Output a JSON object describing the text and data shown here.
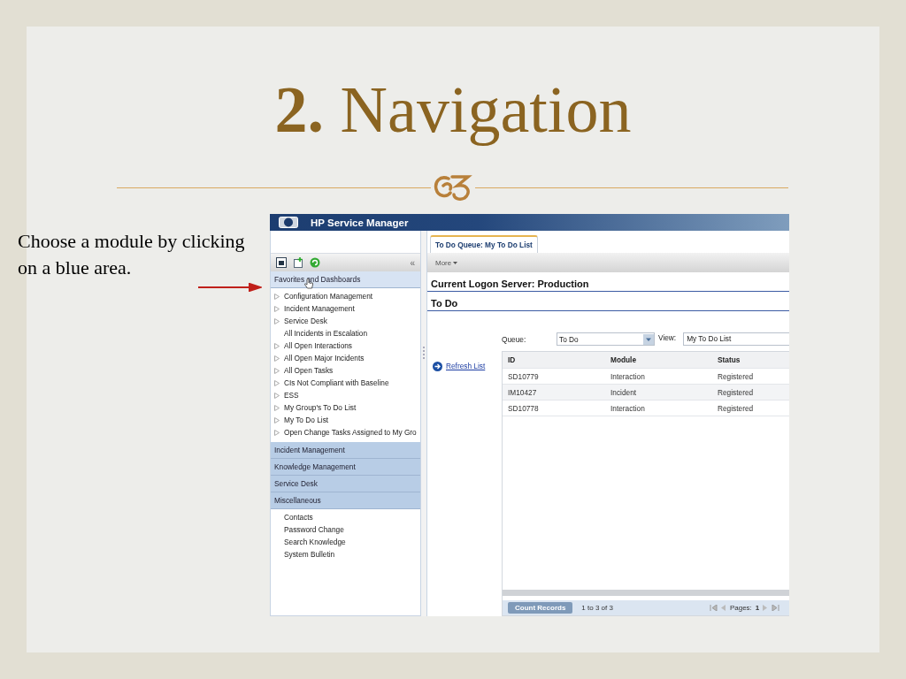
{
  "slide": {
    "title": "**2.** Navigation",
    "caption": "Choose a module by clicking on a blue area."
  },
  "app": {
    "title": "HP Service Manager",
    "sidebar": {
      "collapse": "«",
      "sections": [
        {
          "label": "Favorites and Dashboards",
          "selected": true,
          "items": [
            {
              "label": "Configuration Management",
              "expandable": true
            },
            {
              "label": "Incident Management",
              "expandable": true
            },
            {
              "label": "Service Desk",
              "expandable": true
            },
            {
              "label": "All Incidents in Escalation",
              "expandable": false
            },
            {
              "label": "All Open Interactions",
              "expandable": true
            },
            {
              "label": "All Open Major Incidents",
              "expandable": true
            },
            {
              "label": "All Open Tasks",
              "expandable": true
            },
            {
              "label": "CIs Not Compliant with Baseline",
              "expandable": true
            },
            {
              "label": "ESS",
              "expandable": true
            },
            {
              "label": "My Group's To Do List",
              "expandable": true
            },
            {
              "label": "My To Do List",
              "expandable": true
            },
            {
              "label": "Open Change Tasks Assigned to My Gro",
              "expandable": true
            }
          ]
        },
        {
          "label": "Incident Management",
          "selected": false
        },
        {
          "label": "Knowledge Management",
          "selected": false
        },
        {
          "label": "Service Desk",
          "selected": false
        },
        {
          "label": "Miscellaneous",
          "selected": false,
          "items": [
            {
              "label": "Contacts",
              "expandable": false
            },
            {
              "label": "Password Change",
              "expandable": false
            },
            {
              "label": "Search Knowledge",
              "expandable": false
            },
            {
              "label": "System Bulletin",
              "expandable": false
            }
          ]
        }
      ]
    },
    "tabs": [
      {
        "label": "To Do Queue: My To Do List",
        "selected": true
      }
    ],
    "toolbar": {
      "more": "More"
    },
    "headings": [
      "Current Logon Server: Production",
      "To Do"
    ],
    "queue": {
      "label": "Queue:",
      "value": "To Do"
    },
    "view": {
      "label": "View:",
      "value": "My To Do List"
    },
    "refresh": "Refresh List",
    "table": {
      "columns": [
        "ID",
        "Module",
        "Status"
      ],
      "rows": [
        [
          "SD10779",
          "Interaction",
          "Registered"
        ],
        [
          "IM10427",
          "Incident",
          "Registered"
        ],
        [
          "SD10778",
          "Interaction",
          "Registered"
        ]
      ]
    },
    "pager": {
      "count_button": "Count Records",
      "range": "1 to 3 of 3",
      "pages_label": "Pages:",
      "page": "1"
    }
  }
}
